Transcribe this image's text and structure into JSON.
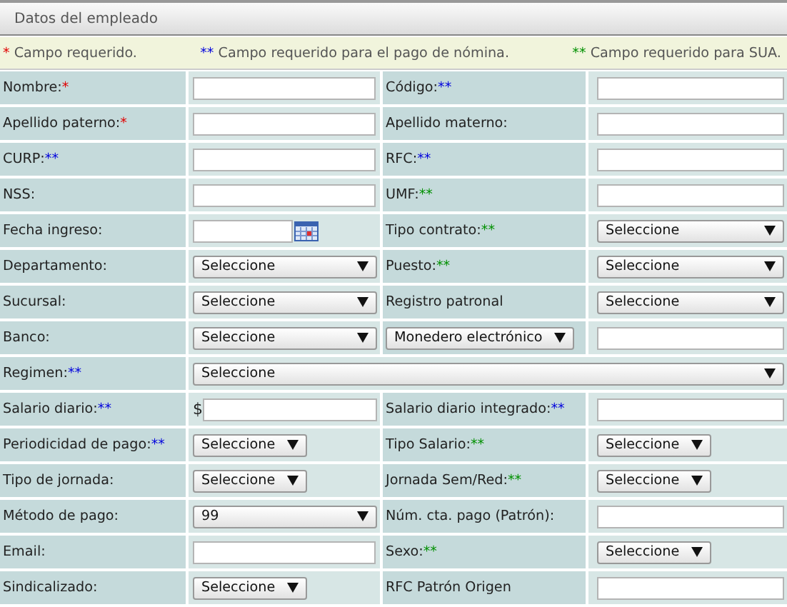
{
  "panel": {
    "title": "Datos del empleado"
  },
  "legend": [
    {
      "mark": "*",
      "color": "#e00000",
      "text": "Campo requerido."
    },
    {
      "mark": "**",
      "color": "#0000dd",
      "text": "Campo requerido para el pago de nómina."
    },
    {
      "mark": "**",
      "color": "#009000",
      "text": "Campo requerido para SUA."
    }
  ],
  "rows": [
    {
      "cells": [
        {
          "kind": "label",
          "text": "Nombre:",
          "mark": "*",
          "color": "#e00000"
        },
        {
          "kind": "text"
        },
        {
          "kind": "label",
          "text": "Código:",
          "mark": "**",
          "color": "#0000dd"
        },
        {
          "kind": "text"
        }
      ]
    },
    {
      "cells": [
        {
          "kind": "label",
          "text": "Apellido paterno:",
          "mark": "*",
          "color": "#e00000"
        },
        {
          "kind": "text"
        },
        {
          "kind": "label",
          "text": "Apellido materno:"
        },
        {
          "kind": "text"
        }
      ]
    },
    {
      "cells": [
        {
          "kind": "label",
          "text": "CURP:",
          "mark": "**",
          "color": "#0000dd"
        },
        {
          "kind": "text"
        },
        {
          "kind": "label",
          "text": "RFC:",
          "mark": "**",
          "color": "#0000dd"
        },
        {
          "kind": "text"
        }
      ]
    },
    {
      "cells": [
        {
          "kind": "label",
          "text": "NSS:"
        },
        {
          "kind": "text"
        },
        {
          "kind": "label",
          "text": "UMF:",
          "mark": "**",
          "color": "#009000"
        },
        {
          "kind": "text"
        }
      ]
    },
    {
      "cells": [
        {
          "kind": "label",
          "text": "Fecha ingreso:"
        },
        {
          "kind": "date"
        },
        {
          "kind": "label",
          "text": "Tipo contrato:",
          "mark": "**",
          "color": "#009000"
        },
        {
          "kind": "select",
          "value": "Seleccione",
          "stretch": true
        }
      ]
    },
    {
      "cells": [
        {
          "kind": "label",
          "text": "Departamento:"
        },
        {
          "kind": "select",
          "value": "Seleccione",
          "stretch": true
        },
        {
          "kind": "label",
          "text": "Puesto:",
          "mark": "**",
          "color": "#009000"
        },
        {
          "kind": "select",
          "value": "Seleccione",
          "stretch": true
        }
      ]
    },
    {
      "cells": [
        {
          "kind": "label",
          "text": "Sucursal:"
        },
        {
          "kind": "select",
          "value": "Seleccione",
          "stretch": true
        },
        {
          "kind": "label",
          "text": "Registro patronal"
        },
        {
          "kind": "select",
          "value": "Seleccione",
          "stretch": true
        }
      ]
    },
    {
      "cells": [
        {
          "kind": "label",
          "text": "Banco:"
        },
        {
          "kind": "select",
          "value": "Seleccione",
          "stretch": true
        },
        {
          "kind": "select",
          "value": "Monedero electrónico",
          "stretch": false
        },
        {
          "kind": "text"
        }
      ]
    },
    {
      "cells": [
        {
          "kind": "label",
          "text": "Regimen:",
          "mark": "**",
          "color": "#0000dd"
        },
        {
          "kind": "select",
          "value": "Seleccione",
          "stretch": true
        }
      ]
    },
    {
      "cells": [
        {
          "kind": "label",
          "text": "Salario diario:",
          "mark": "**",
          "color": "#0000dd"
        },
        {
          "kind": "money",
          "prefix": "$"
        },
        {
          "kind": "label",
          "text": "Salario diario integrado:",
          "mark": "**",
          "color": "#0000dd"
        },
        {
          "kind": "text"
        }
      ]
    },
    {
      "cells": [
        {
          "kind": "label",
          "text": "Periodicidad de pago:",
          "mark": "**",
          "color": "#0000dd"
        },
        {
          "kind": "select",
          "value": "Seleccione",
          "stretch": false
        },
        {
          "kind": "label",
          "text": "Tipo Salario:",
          "mark": "**",
          "color": "#009000"
        },
        {
          "kind": "select",
          "value": "Seleccione",
          "stretch": false
        }
      ]
    },
    {
      "cells": [
        {
          "kind": "label",
          "text": "Tipo de jornada:"
        },
        {
          "kind": "select",
          "value": "Seleccione",
          "stretch": false
        },
        {
          "kind": "label",
          "text": "Jornada Sem/Red:",
          "mark": "**",
          "color": "#009000"
        },
        {
          "kind": "select",
          "value": "Seleccione",
          "stretch": false
        }
      ]
    },
    {
      "cells": [
        {
          "kind": "label",
          "text": "Método de pago:"
        },
        {
          "kind": "select",
          "value": "99",
          "stretch": true
        },
        {
          "kind": "label",
          "text": "Núm. cta. pago (Patrón):"
        },
        {
          "kind": "text"
        }
      ]
    },
    {
      "cells": [
        {
          "kind": "label",
          "text": "Email:"
        },
        {
          "kind": "text"
        },
        {
          "kind": "label",
          "text": "Sexo:",
          "mark": "**",
          "color": "#009000"
        },
        {
          "kind": "select",
          "value": "Seleccione",
          "stretch": false
        }
      ]
    },
    {
      "cells": [
        {
          "kind": "label",
          "text": "Sindicalizado:"
        },
        {
          "kind": "select",
          "value": "Seleccione",
          "stretch": false
        },
        {
          "kind": "label",
          "text": "RFC Patrón Origen"
        },
        {
          "kind": "text"
        }
      ]
    }
  ]
}
